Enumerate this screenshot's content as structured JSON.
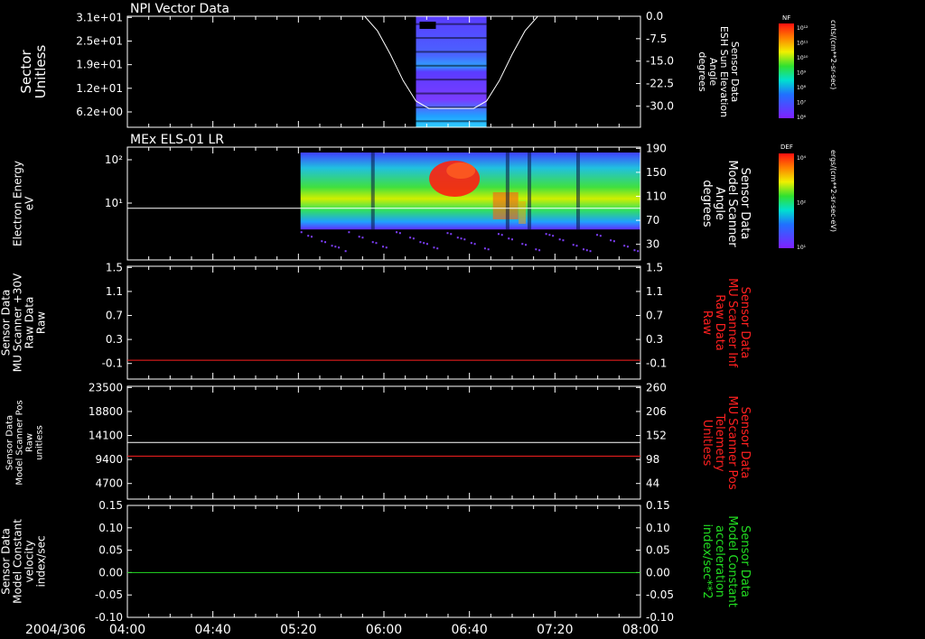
{
  "header": {
    "date_label": "2004/306"
  },
  "colors": {
    "frame": "#ffffff",
    "red": "#ff2020",
    "green": "#22dd22",
    "white": "#ffffff"
  },
  "time_axis": {
    "ticks": [
      "04:00",
      "04:40",
      "05:20",
      "06:00",
      "06:40",
      "07:20",
      "08:00"
    ],
    "range_hours": [
      4.0,
      8.0
    ]
  },
  "colorbars": [
    {
      "label": "NF",
      "unit": "cnts/(cm**2-sr-sec)",
      "ticks": [
        "10¹²",
        "10¹¹",
        "10¹⁰",
        "10⁹",
        "10⁸",
        "10⁷",
        "10⁶"
      ]
    },
    {
      "label": "DEF",
      "unit": "ergs/(cm**2-sr-sec-eV)",
      "ticks": [
        "10⁴",
        "10²",
        "10¹"
      ]
    }
  ],
  "chart_data": [
    {
      "type": "heatmap",
      "title": "NPI Vector Data",
      "ylabel": [
        "Sector",
        "Unitless"
      ],
      "ylabel_right": [
        "Sensor Data",
        "ESH Sun Elevation",
        "Angle",
        "degrees"
      ],
      "yticks_left": [
        "3.1e+01",
        "2.5e+01",
        "1.9e+01",
        "1.2e+01",
        "6.2e+00"
      ],
      "yticks_right": [
        "0.0",
        "-7.5",
        "-15.0",
        "-22.5",
        "-30.0"
      ],
      "data_window_hours": [
        6.25,
        6.8
      ],
      "overlay_line": {
        "name": "ESH Sun Elevation Angle",
        "x_hours": [
          4.0,
          5.85,
          5.95,
          6.05,
          6.15,
          6.25,
          6.35,
          6.7,
          6.8,
          6.9,
          7.0,
          7.1,
          7.2,
          8.0
        ],
        "y": [
          0.0,
          0.0,
          -5.0,
          -13.0,
          -22.0,
          -29.0,
          -31.5,
          -31.5,
          -29.0,
          -22.0,
          -13.0,
          -5.0,
          0.0,
          0.0
        ]
      }
    },
    {
      "type": "heatmap",
      "title": "MEx ELS-01 LR",
      "ylabel": [
        "Electron Energy",
        "eV"
      ],
      "ylabel_right": [
        "Sensor Data",
        "Model Scanner",
        "Angle",
        "degrees"
      ],
      "yticks_left": [
        "10²",
        "10¹"
      ],
      "yticks_right": [
        "190",
        "150",
        "110",
        "70",
        "30"
      ],
      "data_window_hours": [
        5.35,
        8.0
      ],
      "overlay_line": {
        "name": "Model Scanner Angle",
        "value": 85
      }
    },
    {
      "type": "line",
      "ylabel": [
        "Sensor Data",
        "MU Scanner +30V",
        "Raw Data",
        "Raw"
      ],
      "ylabel_right": [
        "Sensor Data",
        "MU Scanner Inf",
        "Raw Data",
        "Raw"
      ],
      "yticks_left": [
        "1.5",
        "1.1",
        "0.7",
        "0.3",
        "-0.1"
      ],
      "yticks_right": [
        "1.5",
        "1.1",
        "0.7",
        "0.3",
        "-0.1"
      ],
      "ylim": [
        -0.3,
        1.5
      ],
      "series": [
        {
          "values": [
            0.0,
            0.0
          ],
          "color": "#ff2020"
        }
      ]
    },
    {
      "type": "line",
      "ylabel": [
        "Sensor Data",
        "Model Scanner Pos",
        "Raw",
        "unitless"
      ],
      "ylabel_right": [
        "Sensor Data",
        "MU Scanner Pos",
        "Telemetry",
        "Unitless"
      ],
      "yticks_left": [
        "23500",
        "18800",
        "14100",
        "9400",
        "4700"
      ],
      "yticks_right": [
        "260",
        "206",
        "152",
        "98",
        "44"
      ],
      "ylim": [
        0,
        23500
      ],
      "series": [
        {
          "values": [
            11800,
            11800
          ],
          "color": "#ffffff"
        },
        {
          "values": [
            8950,
            8950
          ],
          "color": "#ff2020"
        }
      ]
    },
    {
      "type": "line",
      "ylabel": [
        "Sensor Data",
        "Model Constant",
        "velocity",
        "index/sec"
      ],
      "ylabel_right": [
        "Sensor Data",
        "Model Constant",
        "acceleration",
        "index/sec**2"
      ],
      "yticks_left": [
        "0.15",
        "0.10",
        "0.05",
        "0.00",
        "-0.05",
        "-0.10"
      ],
      "yticks_right": [
        "0.15",
        "0.10",
        "0.05",
        "0.00",
        "-0.05",
        "-0.10"
      ],
      "ylim": [
        -0.1,
        0.15
      ],
      "series": [
        {
          "values": [
            0.0,
            0.0
          ],
          "color": "#22dd22"
        }
      ]
    }
  ]
}
